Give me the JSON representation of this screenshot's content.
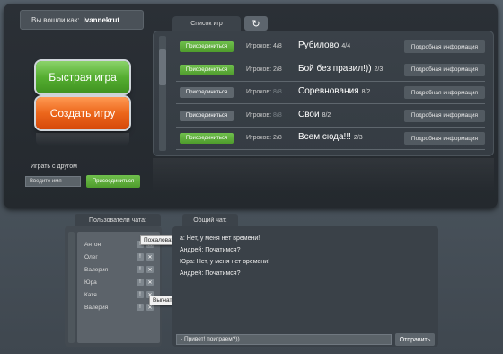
{
  "login": {
    "label": "Вы вошли как:",
    "username": "ivannekrut"
  },
  "quick_game_label": "Быстрая игра",
  "create_game_label": "Создать игру",
  "play_with_friend": {
    "label": "Играть с другом",
    "input_placeholder": "Введите имя",
    "join_label": "Присоединиться"
  },
  "games_tab": {
    "label": "Список игр",
    "refresh_icon": "refresh-icon"
  },
  "games": [
    {
      "join_label": "Присоединиться",
      "join_active": true,
      "players_label": "Игроков:",
      "players": "4/8",
      "name": "Рубилово",
      "sub": "4/4",
      "info_label": "Подробная информация"
    },
    {
      "join_label": "Присоединиться",
      "join_active": true,
      "players_label": "Игроков:",
      "players": "2/8",
      "name": "Бой без правил!))",
      "sub": "2/3",
      "info_label": "Подробная информация"
    },
    {
      "join_label": "Присоединиться",
      "join_active": false,
      "players_label": "Игроков:",
      "players": "8/8",
      "name": "Соревнования",
      "sub": "8/2",
      "info_label": "Подробная информация"
    },
    {
      "join_label": "Присоединиться",
      "join_active": false,
      "players_label": "Игроков:",
      "players": "8/8",
      "name": "Свои",
      "sub": "8/2",
      "info_label": "Подробная информация"
    },
    {
      "join_label": "Присоединиться",
      "join_active": true,
      "players_label": "Игроков:",
      "players": "2/8",
      "name": "Всем сюда!!!",
      "sub": "2/3",
      "info_label": "Подробная информация"
    }
  ],
  "users_tab_label": "Пользователи чата:",
  "users": [
    "Антон",
    "Олег",
    "Валерия",
    "Юра",
    "Катя",
    "Валерия"
  ],
  "tooltips": {
    "complain": "Пожаловаться",
    "kick": "Выгнать"
  },
  "chat_tab_label": "Общий чат:",
  "chat_messages": [
    "а: Нет, у меня нет времени!",
    "Андрей: Початимся?",
    "Юра: Нет, у меня нет времени!",
    "Андрей: Початимся?"
  ],
  "chat_input_value": "- Привет! поиграем?))",
  "send_label": "Отправить"
}
